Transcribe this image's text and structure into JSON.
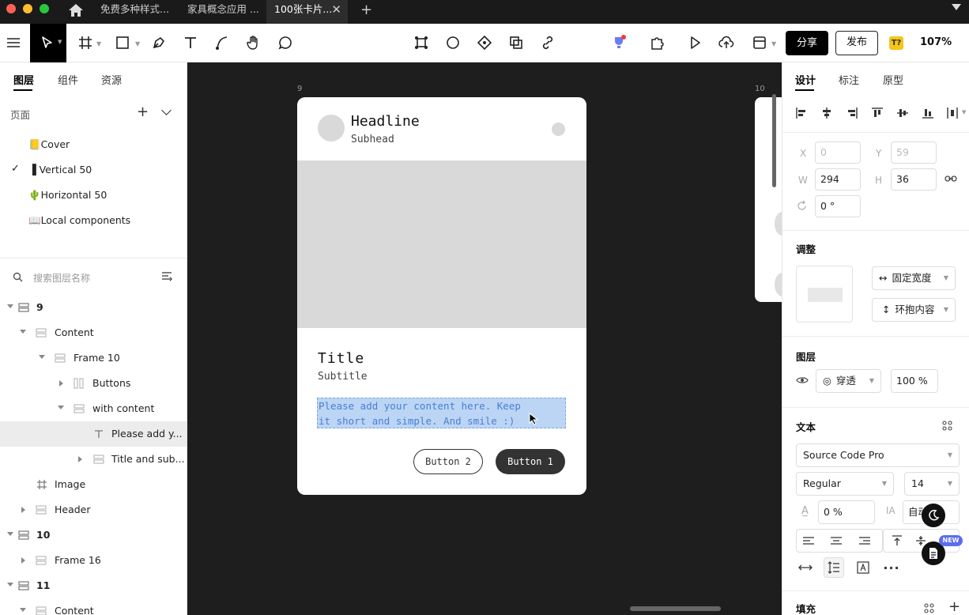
{
  "tabs": [
    {
      "label": "免费多种样式..."
    },
    {
      "label": "家具概念应用 ..."
    },
    {
      "label": "100张卡片..."
    }
  ],
  "toolbar": {
    "share_label": "分享",
    "publish_label": "发布",
    "badge_label": "T?",
    "zoom": "107%"
  },
  "left_panel": {
    "tabs": [
      "图层",
      "组件",
      "资源"
    ],
    "pages_label": "页面",
    "pages": [
      {
        "label": "📒Cover"
      },
      {
        "label": "▐ Vertical 50",
        "checked": true
      },
      {
        "label": "🌵Horizontal 50"
      },
      {
        "label": "📖Local components"
      }
    ],
    "search_placeholder": "搜索图层名称",
    "layers": [
      {
        "label": "9"
      },
      {
        "label": "Content"
      },
      {
        "label": "Frame 10"
      },
      {
        "label": "Buttons"
      },
      {
        "label": "with content"
      },
      {
        "label": "Please add y..."
      },
      {
        "label": "Title and sub..."
      },
      {
        "label": "Image"
      },
      {
        "label": "Header"
      },
      {
        "label": "10"
      },
      {
        "label": "Frame 16"
      },
      {
        "label": "11"
      },
      {
        "label": "Content"
      }
    ]
  },
  "canvas": {
    "frame9_label": "9",
    "frame10_label": "10",
    "card": {
      "headline": "Headline",
      "subhead": "Subhead",
      "title": "Title",
      "subtitle": "Subtitle",
      "content_line1": "Please add your content here. Keep",
      "content_line2": "it short and simple. And smile :)",
      "button2": "Button 2",
      "button1": "Button 1"
    }
  },
  "right_panel": {
    "tabs": [
      "设计",
      "标注",
      "原型"
    ],
    "x_label": "X",
    "x_value": "0",
    "y_label": "Y",
    "y_value": "59",
    "w_label": "W",
    "w_value": "294",
    "h_label": "H",
    "h_value": "36",
    "rotation_value": "0 °",
    "adjust_title": "调整",
    "width_mode": "固定宽度",
    "height_mode": "环抱内容",
    "layer_title": "图层",
    "blend_mode": "穿透",
    "opacity": "100 %",
    "text_title": "文本",
    "font_family": "Source Code Pro",
    "font_weight": "Regular",
    "font_size": "14",
    "letter_spacing": "0 %",
    "line_height": "自动",
    "fill_title": "填充",
    "new_badge": "NEW"
  }
}
